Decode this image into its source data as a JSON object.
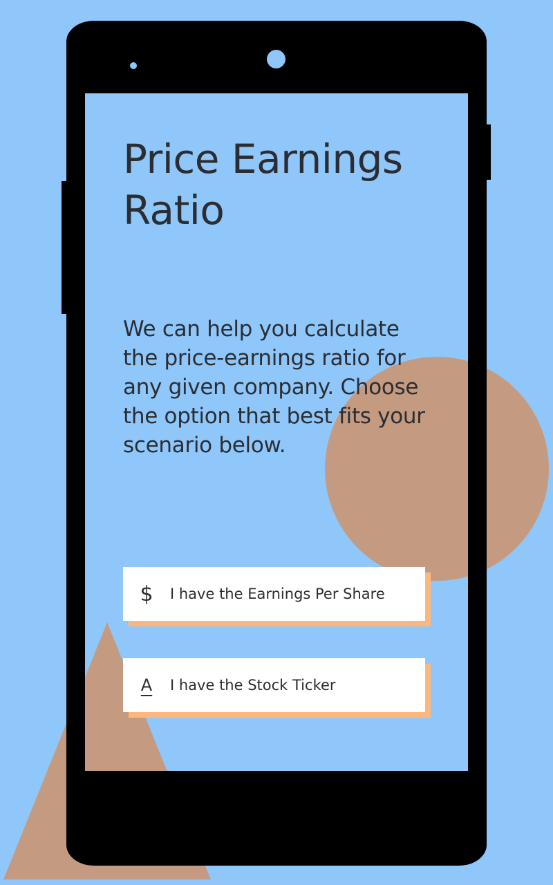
{
  "colors": {
    "background": "#8fc7fb",
    "phone": "#000000",
    "circle": "#c49b81",
    "triangle": "#c49b81",
    "button_bg": "#ffffff",
    "button_shadow": "#fbb87e",
    "text": "#2b2d32"
  },
  "screen": {
    "title": "Price Earnings Ratio",
    "description": "We can help you calculate the price-earnings ratio for any given company. Choose the option that best fits your scenario below.",
    "options": [
      {
        "icon": "$",
        "icon_name": "dollar-icon",
        "label": "I have the Earnings Per Share"
      },
      {
        "icon": "A",
        "icon_name": "ticker-icon",
        "label": "I have the Stock Ticker"
      }
    ]
  }
}
